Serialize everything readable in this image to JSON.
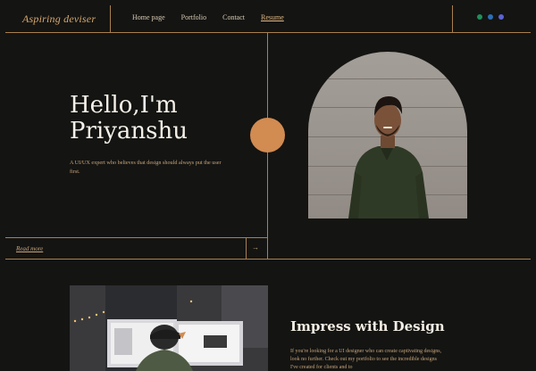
{
  "header": {
    "brand": "Aspiring deviser",
    "nav": [
      {
        "label": "Home page",
        "active": false
      },
      {
        "label": "Portfolio",
        "active": false
      },
      {
        "label": "Contact",
        "active": false
      },
      {
        "label": "Resume",
        "active": true
      }
    ],
    "social_icons": [
      "whatsapp-icon",
      "linkedin-icon",
      "discord-icon"
    ]
  },
  "hero": {
    "title_line1": "Hello,I'm",
    "title_line2": "Priyanshu",
    "description": "A UI/UX expert who believes that design should always put the user first.",
    "read_more": "Read more",
    "arrow": "→"
  },
  "section": {
    "title": "Impress with Design",
    "text": "If you're looking for a UI designer who can create captivating designs, look no further. Check out my portfolio to see the incredible designs I've created for clients and to"
  },
  "colors": {
    "background": "#141412",
    "accent": "#d28b51",
    "line": "#a9804f",
    "text": "#f5f1e9"
  }
}
